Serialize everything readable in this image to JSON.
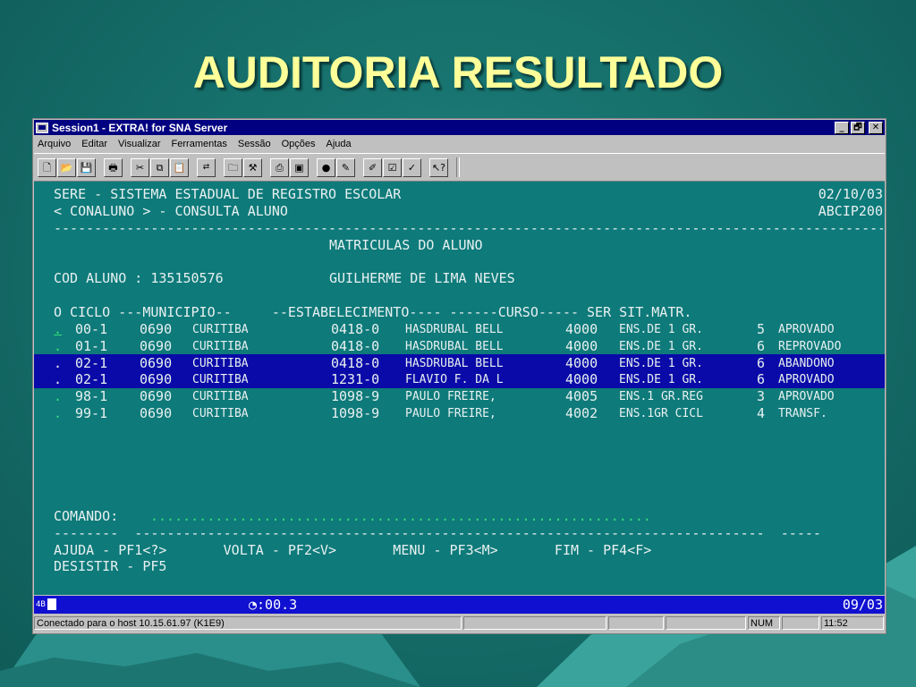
{
  "slide": {
    "title": "AUDITORIA RESULTADO"
  },
  "window": {
    "title": "Session1 - EXTRA! for SNA Server",
    "controls": {
      "minimize": "_",
      "restore": "🗗",
      "close": "✕"
    }
  },
  "menu": [
    "Arquivo",
    "Editar",
    "Visualizar",
    "Ferramentas",
    "Sessão",
    "Opções",
    "Ajuda"
  ],
  "toolbar": {
    "groups": [
      [
        "new-icon",
        "open-icon",
        "save-icon"
      ],
      [
        "print-icon"
      ],
      [
        "cut-icon",
        "copy-icon",
        "paste-icon"
      ],
      [
        "transfer-icon"
      ],
      [
        "folder-icon",
        "tools-icon"
      ],
      [
        "print-screen-icon",
        "clear-icon"
      ],
      [
        "record-icon",
        "macro-icon"
      ],
      [
        "edit-icon",
        "form-icon",
        "check-icon"
      ],
      [
        "help-icon"
      ]
    ]
  },
  "terminal": {
    "header1": "SERE - SISTEMA ESTADUAL DE REGISTRO ESCOLAR",
    "date": "02/10/03",
    "header2": "< CONALUNO > - CONSULTA ALUNO",
    "user": "ABCIP200",
    "divider": "-------------------------------------------------------------------------------------------------------------- CELEPAR --",
    "section": "MATRICULAS DO ALUNO",
    "cod_label": "COD ALUNO : ",
    "cod_value": "135150576",
    "student_name": "GUILHERME DE LIMA NEVES",
    "columns": "O CICLO ---MUNICIPIO--     --ESTABELECIMENTO---- ------CURSO----- SER SIT.MATR.",
    "rows": [
      {
        "o": ".",
        "ciclo": "00-1",
        "mun_code": "0690",
        "mun_name": "CURITIBA",
        "est_code": "0418-0",
        "est_name": "HASDRUBAL BELL",
        "curso_code": "4000",
        "curso_name": "ENS.DE 1 GR.",
        "ser": "5",
        "sit": "APROVADO"
      },
      {
        "o": ".",
        "ciclo": "01-1",
        "mun_code": "0690",
        "mun_name": "CURITIBA",
        "est_code": "0418-0",
        "est_name": "HASDRUBAL BELL",
        "curso_code": "4000",
        "curso_name": "ENS.DE 1 GR.",
        "ser": "6",
        "sit": "REPROVADO"
      },
      {
        "o": ".",
        "ciclo": "02-1",
        "mun_code": "0690",
        "mun_name": "CURITIBA",
        "est_code": "0418-0",
        "est_name": "HASDRUBAL BELL",
        "curso_code": "4000",
        "curso_name": "ENS.DE 1 GR.",
        "ser": "6",
        "sit": "ABANDONO"
      },
      {
        "o": ".",
        "ciclo": "02-1",
        "mun_code": "0690",
        "mun_name": "CURITIBA",
        "est_code": "1231-0",
        "est_name": "FLAVIO F. DA L",
        "curso_code": "4000",
        "curso_name": "ENS.DE 1 GR.",
        "ser": "6",
        "sit": "APROVADO"
      },
      {
        "o": ".",
        "ciclo": "98-1",
        "mun_code": "0690",
        "mun_name": "CURITIBA",
        "est_code": "1098-9",
        "est_name": "PAULO FREIRE,",
        "curso_code": "4005",
        "curso_name": "ENS.1 GR.REG",
        "ser": "3",
        "sit": "APROVADO"
      },
      {
        "o": ".",
        "ciclo": "99-1",
        "mun_code": "0690",
        "mun_name": "CURITIBA",
        "est_code": "1098-9",
        "est_name": "PAULO FREIRE,",
        "curso_code": "4002",
        "curso_name": "ENS.1GR CICL",
        "ser": "4",
        "sit": "TRANSF."
      }
    ],
    "command_label": "COMANDO:",
    "command_value": "..............................................................",
    "command_divider": "--------  ------------------------------------------------------------------------------  -----",
    "pf_line1": "AJUDA - PF1<?>       VOLTA - PF2<V>       MENU - PF3<M>       FIM - PF4<F>",
    "pf_line2": "DESISTIR - PF5"
  },
  "oia": {
    "left": "4B",
    "timer": "◔:00.3",
    "cursor": "09/03"
  },
  "statusbar": {
    "connection": "Conectado para o host 10.15.61.97 (K1E9)",
    "num": "NUM",
    "time": "11:52"
  }
}
